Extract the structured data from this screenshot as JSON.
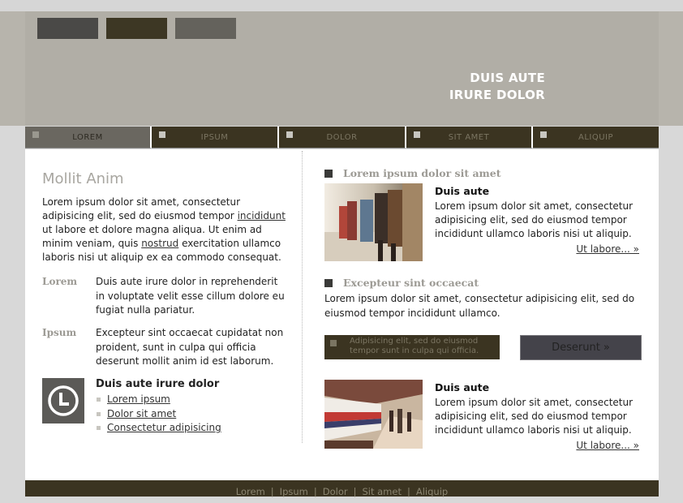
{
  "header": {
    "slogan_line1": "DUIS AUTE",
    "slogan_line2": "IRURE DOLOR"
  },
  "nav": {
    "items": [
      {
        "label": "LOREM",
        "active": true
      },
      {
        "label": "IPSUM",
        "active": false
      },
      {
        "label": "DOLOR",
        "active": false
      },
      {
        "label": "SIT AMET",
        "active": false
      },
      {
        "label": "ALIQUIP",
        "active": false
      }
    ]
  },
  "left": {
    "title": "Mollit Anim",
    "intro_part1": "Lorem ipsum dolor sit amet, consectetur adipisicing elit, sed do eiusmod tempor ",
    "intro_link1": "incididunt",
    "intro_part2": " ut labore et dolore magna aliqua. Ut enim ad minim veniam, quis ",
    "intro_link2": "nostrud",
    "intro_part3": " exercitation ullamco laboris nisi ut aliquip ex ea commodo consequat.",
    "defs": [
      {
        "term": "Lorem",
        "desc": "Duis aute irure dolor in reprehenderit in voluptate velit esse cillum dolore eu fugiat nulla pariatur."
      },
      {
        "term": "Ipsum",
        "desc": "Excepteur sint occaecat cupidatat non proident, sunt in culpa qui officia deserunt mollit anim id est laborum."
      }
    ],
    "list_heading": "Duis aute irure dolor",
    "list_items": [
      "Lorem ipsum",
      "Dolor sit amet",
      "Consectetur adipisicing"
    ]
  },
  "right": {
    "section1": {
      "heading": "Lorem ipsum dolor sit amet",
      "article_title": "Duis aute",
      "article_text": "Lorem ipsum dolor sit amet, consectetur adipisicing elit, sed do eiusmod tempor incididunt ullamco laboris nisi ut aliquip.",
      "more": "Ut labore... »"
    },
    "section2": {
      "heading": "Excepteur sint occaecat",
      "text": "Lorem ipsum dolor sit amet, consectetur adipisicing elit, sed do eiusmod tempor incididunt ullamco."
    },
    "promo": {
      "line1": "Adipisicing elit, sed do eiusmod",
      "line2": "tempor sunt in culpa qui officia."
    },
    "button": "Deserunt »",
    "section3": {
      "article_title": "Duis aute",
      "article_text": "Lorem ipsum dolor sit amet, consectetur adipisicing elit, sed do eiusmod tempor incididunt ullamco laboris nisi ut aliquip.",
      "more": "Ut labore... »"
    }
  },
  "footer": {
    "links": [
      "Lorem",
      "Ipsum",
      "Dolor",
      "Sit amet",
      "Aliquip"
    ],
    "separator": "|"
  },
  "colors": {
    "header_bg": "#b1aea6",
    "nav_bg": "#3b3421",
    "nav_active_bg": "#6a6760",
    "accent_gray": "#9c9a94"
  }
}
